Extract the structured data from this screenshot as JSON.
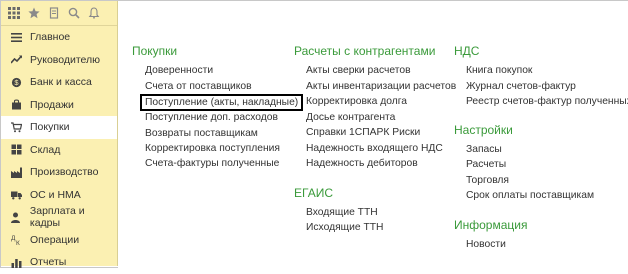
{
  "sidebar": {
    "items": [
      {
        "label": "Главное",
        "icon": "menu-icon"
      },
      {
        "label": "Руководителю",
        "icon": "trend-icon"
      },
      {
        "label": "Банк и касса",
        "icon": "bank-icon"
      },
      {
        "label": "Продажи",
        "icon": "bag-icon"
      },
      {
        "label": "Покупки",
        "icon": "cart-icon",
        "active": true
      },
      {
        "label": "Склад",
        "icon": "warehouse-icon"
      },
      {
        "label": "Производство",
        "icon": "factory-icon"
      },
      {
        "label": "ОС и НМА",
        "icon": "truck-icon"
      },
      {
        "label": "Зарплата и кадры",
        "icon": "person-icon"
      },
      {
        "label": "Операции",
        "icon": "operations-icon"
      },
      {
        "label": "Отчеты",
        "icon": "bar-chart-icon"
      }
    ]
  },
  "sections": {
    "purchases": {
      "title": "Покупки",
      "links": [
        "Доверенности",
        "Счета от поставщиков",
        "Поступление (акты, накладные)",
        "Поступление доп. расходов",
        "Возвраты поставщикам",
        "Корректировка поступления",
        "Счета-фактуры полученные"
      ]
    },
    "settlements": {
      "title": "Расчеты с контрагентами",
      "links": [
        "Акты сверки расчетов",
        "Акты инвентаризации расчетов",
        "Корректировка долга",
        "Досье контрагента",
        "Справки 1СПАРК Риски",
        "Надежность входящего НДС",
        "Надежность дебиторов"
      ]
    },
    "egais": {
      "title": "ЕГАИС",
      "links": [
        "Входящие ТТН",
        "Исходящие ТТН"
      ]
    },
    "vat": {
      "title": "НДС",
      "links": [
        "Книга покупок",
        "Журнал счетов-фактур",
        "Реестр счетов-фактур полученных"
      ]
    },
    "settings": {
      "title": "Настройки",
      "links": [
        "Запасы",
        "Расчеты",
        "Торговля",
        "Срок оплаты поставщикам"
      ]
    },
    "info": {
      "title": "Информация",
      "links": [
        "Новости"
      ]
    }
  }
}
